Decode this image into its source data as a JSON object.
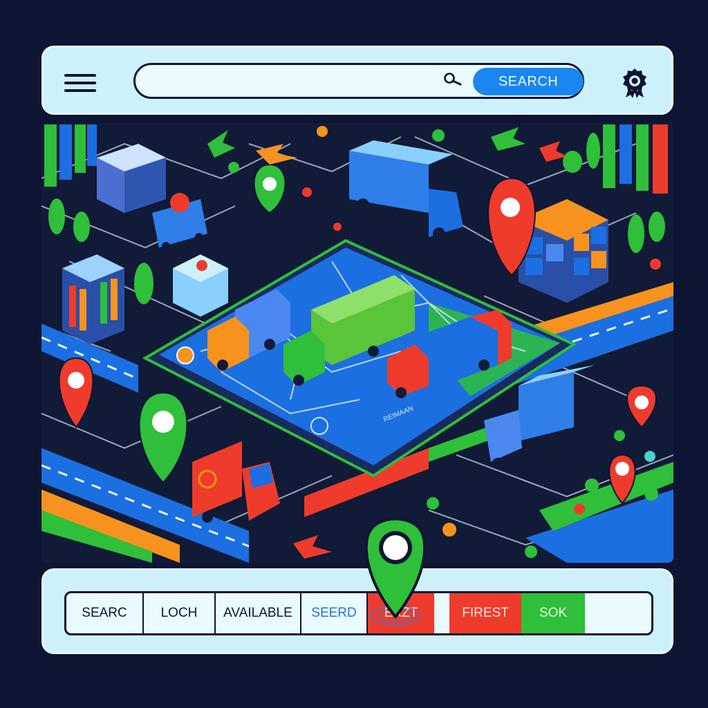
{
  "header": {
    "menu_icon": "hamburger-icon",
    "search_placeholder": "",
    "search_icon": "magnifier-icon",
    "search_button_label": "SEARCH",
    "badge_icon": "award-badge-icon"
  },
  "footer": {
    "buttons": [
      {
        "id": "searc",
        "label": "SEARC"
      },
      {
        "id": "loch",
        "label": "LOCH"
      },
      {
        "id": "available",
        "label": "AVAILABLE"
      },
      {
        "id": "seerd",
        "label": "SEERD"
      },
      {
        "id": "exzt",
        "label": "EXZT"
      },
      {
        "id": "first",
        "label": "FIREST"
      },
      {
        "id": "sok",
        "label": "SOK"
      }
    ]
  },
  "map": {
    "center_label": "REIMAAN"
  },
  "colors": {
    "background": "#0d1533",
    "panel": "#cdf1fb",
    "accent_blue": "#1a86f0",
    "accent_green": "#2fbf3a",
    "accent_red": "#ee3b2c",
    "accent_orange": "#f7931e"
  }
}
